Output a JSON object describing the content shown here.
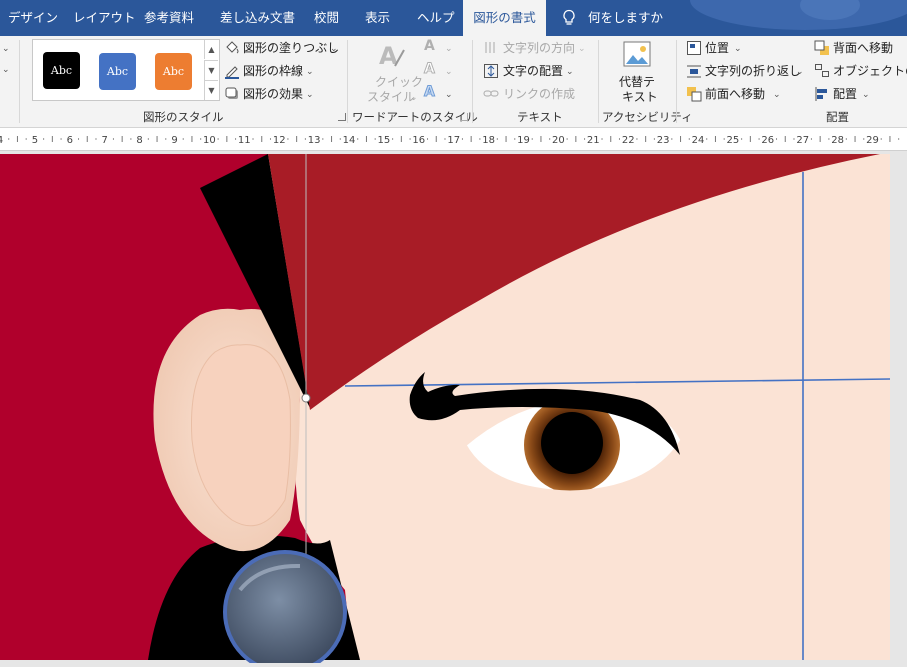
{
  "tabs": [
    {
      "label": "デザイン",
      "active": false
    },
    {
      "label": "レイアウト",
      "active": false
    },
    {
      "label": "参考資料",
      "active": false
    },
    {
      "label": "差し込み文書",
      "active": false
    },
    {
      "label": "校閲",
      "active": false
    },
    {
      "label": "表示",
      "active": false
    },
    {
      "label": "ヘルプ",
      "active": false
    },
    {
      "label": "図形の書式",
      "active": true
    }
  ],
  "tell_me": {
    "label": "何をしますか",
    "icon": "lightbulb-icon"
  },
  "ribbon": {
    "shape_styles": {
      "group_label": "図形のスタイル",
      "swatches": [
        {
          "label": "Abc",
          "color": "#000000"
        },
        {
          "label": "Abc",
          "color": "#4472c4"
        },
        {
          "label": "Abc",
          "color": "#ed7d31"
        }
      ],
      "fill": "図形の塗りつぶし",
      "outline": "図形の枠線",
      "effects": "図形の効果"
    },
    "wordart": {
      "group_label": "ワードアートのスタイル",
      "quick_style_line1": "クイック",
      "quick_style_line2": "スタイル"
    },
    "text": {
      "group_label": "テキスト",
      "direction": "文字列の方向",
      "align": "文字の配置",
      "link": "リンクの作成"
    },
    "accessibility": {
      "group_label": "アクセシビリティ",
      "alt_text_line1": "代替テ",
      "alt_text_line2": "キスト"
    },
    "arrange": {
      "group_label": "配置",
      "position": "位置",
      "wrap": "文字列の折り返し",
      "bring_forward": "前面へ移動",
      "send_backward": "背面へ移動",
      "selection_pane": "オブジェクトの選択",
      "align": "配置"
    }
  },
  "ruler": {
    "labels": [
      "4",
      "5",
      "6",
      "7",
      "8",
      "9",
      "10",
      "11",
      "12",
      "13",
      "14",
      "15",
      "16",
      "17",
      "18",
      "19",
      "20",
      "21",
      "22",
      "23",
      "24",
      "25",
      "26",
      "27",
      "28",
      "29"
    ]
  },
  "colors": {
    "tab_bar": "#2b579a",
    "ribbon": "#f3f3f3",
    "background_red": "#b0002c",
    "hair_red": "#a81c26",
    "skin": "#fbe3d5",
    "guide_blue": "#4472c4"
  }
}
